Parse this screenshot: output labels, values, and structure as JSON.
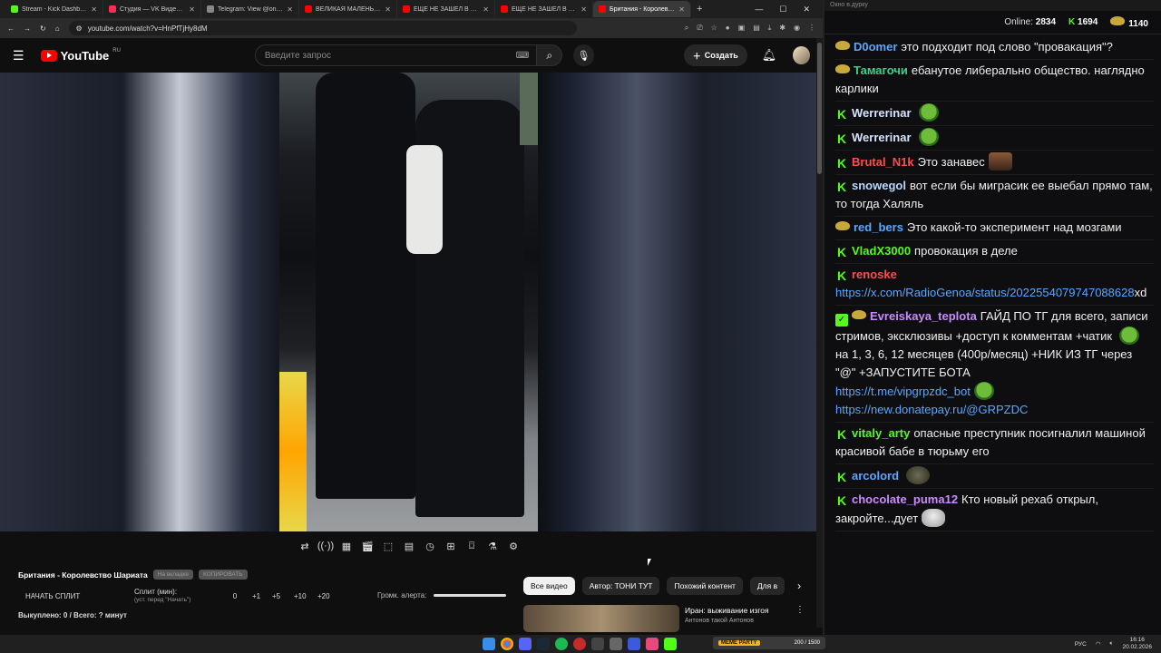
{
  "browser": {
    "tabs": [
      {
        "title": "Stream - Kick Dashboard",
        "color": "#53fc18"
      },
      {
        "title": "Студия — VK Видео Live",
        "color": "#ff2d55"
      },
      {
        "title": "Telegram: View @one_big_...",
        "color": "#888888"
      },
      {
        "title": "ВЕЛИКАЯ МАЛЕНЬКАЯ БРИ...",
        "color": "#ff0000"
      },
      {
        "title": "ЕЩЕ НЕ ЗАШЕЛ В MAX, А Д...",
        "color": "#ff0000"
      },
      {
        "title": "ЕЩЕ НЕ ЗАШЕЛ В MAX, А Д...",
        "color": "#ff0000"
      },
      {
        "title": "Британия - Королевство",
        "color": "#ff0000"
      }
    ],
    "url": "youtube.com/watch?v=HnPfTjHy8dM"
  },
  "youtube": {
    "logo_text": "YouTube",
    "logo_region": "RU",
    "search_placeholder": "Введите запрос",
    "create_label": "Создать"
  },
  "panel": {
    "video_title": "Британия - Королевство Шариата",
    "pill_1": "На вкладке",
    "pill_2": "КОПИРОВАТЬ",
    "split_button": "НАЧАТЬ СПЛИТ",
    "split_label": "Сплит (мин):",
    "split_hint": "(уст. перед \"Начать\")",
    "split_value": "0",
    "steps": [
      "+1",
      "+5",
      "+10",
      "+20"
    ],
    "bought": "Выкуплено: 0 / Всего: ? минут",
    "alert_volume_label": "Громк. алерта:"
  },
  "chips": [
    "Все видео",
    "Автор: ТОНИ ТУТ",
    "Похожий контент",
    "Для в"
  ],
  "recommendation": {
    "title": "Иран: выживание изгоя",
    "channel": "Антонов такой Антонов"
  },
  "chat": {
    "window_title": "Окно в.дурку",
    "online_label": "Online:",
    "online_count": "2834",
    "kick_count": "1694",
    "sub_count": "1140",
    "messages": [
      {
        "badge": "sub",
        "user": "D0omer",
        "color": "#5aa7ff",
        "text": "это подходит под слово \"провакация\"?"
      },
      {
        "badge": "sub",
        "user": "Тамагочи",
        "color": "#3ecf8e",
        "text": "ебанутое либерально общество. наглядно карлики"
      },
      {
        "badge": "k",
        "user": "Werrerinar",
        "color": "#d6e4ff",
        "text": "",
        "emote": "pepe"
      },
      {
        "badge": "k",
        "user": "Werrerinar",
        "color": "#d6e4ff",
        "text": "",
        "emote": "pepe"
      },
      {
        "badge": "k",
        "user": "Brutal_N1k",
        "color": "#ff4d4d",
        "text": "Это занавес",
        "emote": "face"
      },
      {
        "badge": "k",
        "user": "snowegol",
        "color": "#b8d8ff",
        "text": "вот если бы миграсик ее выебал прямо там, то тогда Халяль"
      },
      {
        "badge": "sub",
        "user": "red_bers",
        "color": "#5aa7ff",
        "text": "Это какой-то эксперимент над мозгами"
      },
      {
        "badge": "k",
        "user": "VladX3000",
        "color": "#53fc18",
        "text": "провокация в деле"
      },
      {
        "badge": "k",
        "user": "renoske",
        "color": "#ff4d4d",
        "text": "",
        "link": "https://x.com/RadioGenoa/status/2022554079747088628",
        "after": "xd"
      },
      {
        "badge": "mod",
        "user": "Evreiskaya_teplota",
        "color": "#c98bff",
        "text": "ГАЙД ПО ТГ для всего, записи стримов, эксклюзивы +доступ к комментам +чатик",
        "text2": "на 1, 3, 6, 12 месяцев (400р/месяц) +НИК ИЗ ТГ через \"@\" +ЗАПУСТИТЕ БОТА",
        "link": "https://t.me/vipgrpzdc_bot",
        "link2": "https://new.donatepay.ru/@GRPZDC"
      },
      {
        "badge": "k",
        "user": "vitaly_arty",
        "color": "#53fc18",
        "text": "опасные преступник посигналил машиной красивой бабе в тюрьму его"
      },
      {
        "badge": "k",
        "user": "arcolord",
        "color": "#5aa7ff",
        "text": "",
        "emote": "seal"
      },
      {
        "badge": "k",
        "user": "chocolate_puma12",
        "color": "#c98bff",
        "text": "Кто новый рехаб открыл, закройте...дует",
        "emote": "cat"
      }
    ]
  },
  "taskbar": {
    "widget_brand": "MEME PARTY",
    "widget_value": "200 / 1500",
    "lang": "РУС",
    "time": "16:16",
    "date": "20.02.2026"
  }
}
